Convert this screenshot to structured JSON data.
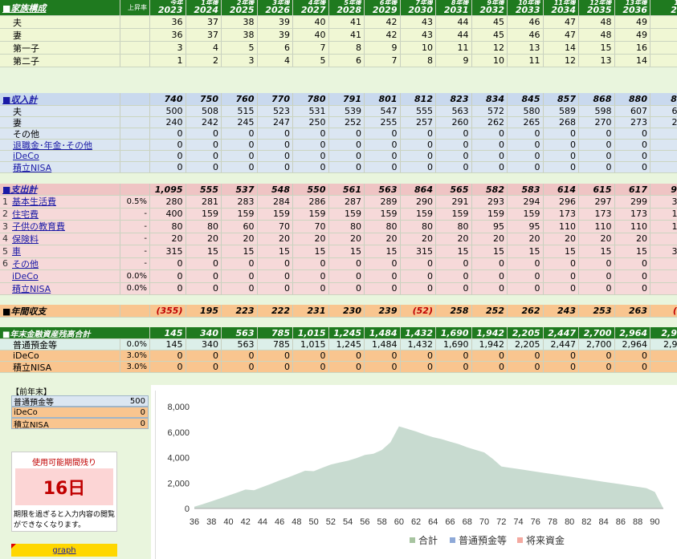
{
  "colors": {
    "navy_header": "#1f2a6e",
    "green_header": "#1f7a1f",
    "family_bg": "#f0f7d4",
    "income_bg": "#dbe6f2",
    "expense_bg": "#f6d9d9",
    "balance_bg": "#f9c58f",
    "assets_bg": "#dcefe9",
    "orange_row": "#f9c58f",
    "sheet_bg": "#e9f5dd",
    "chart_fill": "#c8dbd0"
  },
  "header": {
    "section_label": "■家族構成",
    "year_head_label": "上昇率",
    "years": [
      "2023",
      "2024",
      "2025",
      "2026",
      "2027",
      "2028",
      "2029",
      "2030",
      "2031",
      "2032",
      "2033",
      "2034",
      "2035",
      "2036",
      "20"
    ],
    "age_labels": [
      "今年",
      "1年後",
      "2年後",
      "3年後",
      "4年後",
      "5年後",
      "6年後",
      "7年後",
      "8年後",
      "9年後",
      "10年後",
      "11年後",
      "12年後",
      "13年後",
      "14"
    ]
  },
  "family": [
    {
      "label": "夫",
      "values": [
        "36",
        "37",
        "38",
        "39",
        "40",
        "41",
        "42",
        "43",
        "44",
        "45",
        "46",
        "47",
        "48",
        "49",
        "5"
      ]
    },
    {
      "label": "妻",
      "values": [
        "36",
        "37",
        "38",
        "39",
        "40",
        "41",
        "42",
        "43",
        "44",
        "45",
        "46",
        "47",
        "48",
        "49",
        "5"
      ]
    },
    {
      "label": "第一子",
      "values": [
        "3",
        "4",
        "5",
        "6",
        "7",
        "8",
        "9",
        "10",
        "11",
        "12",
        "13",
        "14",
        "15",
        "16",
        "1"
      ]
    },
    {
      "label": "第二子",
      "values": [
        "1",
        "2",
        "3",
        "4",
        "5",
        "6",
        "7",
        "8",
        "9",
        "10",
        "11",
        "12",
        "13",
        "14",
        "1"
      ]
    }
  ],
  "income": {
    "title": "■収入計",
    "totals": [
      "740",
      "750",
      "760",
      "770",
      "780",
      "791",
      "801",
      "812",
      "823",
      "834",
      "845",
      "857",
      "868",
      "880",
      "89"
    ],
    "rows": [
      {
        "label": "夫",
        "link": false,
        "values": [
          "500",
          "508",
          "515",
          "523",
          "531",
          "539",
          "547",
          "555",
          "563",
          "572",
          "580",
          "589",
          "598",
          "607",
          "61"
        ]
      },
      {
        "label": "妻",
        "link": false,
        "values": [
          "240",
          "242",
          "245",
          "247",
          "250",
          "252",
          "255",
          "257",
          "260",
          "262",
          "265",
          "268",
          "270",
          "273",
          "27"
        ]
      },
      {
        "label": "その他",
        "link": false,
        "values": [
          "0",
          "0",
          "0",
          "0",
          "0",
          "0",
          "0",
          "0",
          "0",
          "0",
          "0",
          "0",
          "0",
          "0",
          "0"
        ]
      },
      {
        "label": "退職金･年金･その他",
        "link": true,
        "values": [
          "0",
          "0",
          "0",
          "0",
          "0",
          "0",
          "0",
          "0",
          "0",
          "0",
          "0",
          "0",
          "0",
          "0",
          "0"
        ]
      },
      {
        "label": "iDeCo",
        "link": true,
        "values": [
          "0",
          "0",
          "0",
          "0",
          "0",
          "0",
          "0",
          "0",
          "0",
          "0",
          "0",
          "0",
          "0",
          "0",
          "0"
        ]
      },
      {
        "label": "積立NISA",
        "link": true,
        "values": [
          "0",
          "0",
          "0",
          "0",
          "0",
          "0",
          "0",
          "0",
          "0",
          "0",
          "0",
          "0",
          "0",
          "0",
          "0"
        ]
      }
    ]
  },
  "expense": {
    "title": "■支出計",
    "totals": [
      "1,095",
      "555",
      "537",
      "548",
      "550",
      "561",
      "563",
      "864",
      "565",
      "582",
      "583",
      "614",
      "615",
      "617",
      "91"
    ],
    "rows": [
      {
        "num": "1",
        "label": "基本生活費",
        "pct": "0.5%",
        "values": [
          "280",
          "281",
          "283",
          "284",
          "286",
          "287",
          "289",
          "290",
          "291",
          "293",
          "294",
          "296",
          "297",
          "299",
          "30"
        ]
      },
      {
        "num": "2",
        "label": "住宅費",
        "pct": "-",
        "values": [
          "400",
          "159",
          "159",
          "159",
          "159",
          "159",
          "159",
          "159",
          "159",
          "159",
          "159",
          "173",
          "173",
          "173",
          "17"
        ]
      },
      {
        "num": "3",
        "label": "子供の教育費",
        "pct": "-",
        "values": [
          "80",
          "80",
          "60",
          "70",
          "70",
          "80",
          "80",
          "80",
          "80",
          "95",
          "95",
          "110",
          "110",
          "110",
          "11"
        ]
      },
      {
        "num": "4",
        "label": "保険料",
        "pct": "-",
        "values": [
          "20",
          "20",
          "20",
          "20",
          "20",
          "20",
          "20",
          "20",
          "20",
          "20",
          "20",
          "20",
          "20",
          "20",
          "2"
        ]
      },
      {
        "num": "5",
        "label": "車",
        "pct": "-",
        "values": [
          "315",
          "15",
          "15",
          "15",
          "15",
          "15",
          "15",
          "315",
          "15",
          "15",
          "15",
          "15",
          "15",
          "15",
          "31"
        ]
      },
      {
        "num": "6",
        "label": "その他",
        "pct": "-",
        "values": [
          "0",
          "0",
          "0",
          "0",
          "0",
          "0",
          "0",
          "0",
          "0",
          "0",
          "0",
          "0",
          "0",
          "0",
          "0"
        ]
      },
      {
        "num": "",
        "label": "iDeCo",
        "pct": "0.0%",
        "values": [
          "0",
          "0",
          "0",
          "0",
          "0",
          "0",
          "0",
          "0",
          "0",
          "0",
          "0",
          "0",
          "0",
          "0",
          "0"
        ]
      },
      {
        "num": "",
        "label": "積立NISA",
        "pct": "0.0%",
        "values": [
          "0",
          "0",
          "0",
          "0",
          "0",
          "0",
          "0",
          "0",
          "0",
          "0",
          "0",
          "0",
          "0",
          "0",
          "0"
        ]
      }
    ]
  },
  "balance": {
    "title": "■年間収支",
    "values": [
      "(355)",
      "195",
      "223",
      "222",
      "231",
      "230",
      "239",
      "(52)",
      "258",
      "252",
      "262",
      "243",
      "253",
      "263",
      "(2"
    ]
  },
  "assets": {
    "title": "■年末金融資産残高合計",
    "totals": [
      "145",
      "340",
      "563",
      "785",
      "1,015",
      "1,245",
      "1,484",
      "1,432",
      "1,690",
      "1,942",
      "2,205",
      "2,447",
      "2,700",
      "2,964",
      "2,93"
    ],
    "rows": [
      {
        "label": "普通預金等",
        "pct": "0.0%",
        "values": [
          "145",
          "340",
          "563",
          "785",
          "1,015",
          "1,245",
          "1,484",
          "1,432",
          "1,690",
          "1,942",
          "2,205",
          "2,447",
          "2,700",
          "2,964",
          "2,93"
        ]
      },
      {
        "label": "iDeCo",
        "pct": "3.0%",
        "values": [
          "0",
          "0",
          "0",
          "0",
          "0",
          "0",
          "0",
          "0",
          "0",
          "0",
          "0",
          "0",
          "0",
          "0",
          "0"
        ]
      },
      {
        "label": "積立NISA",
        "pct": "3.0%",
        "values": [
          "0",
          "0",
          "0",
          "0",
          "0",
          "0",
          "0",
          "0",
          "0",
          "0",
          "0",
          "0",
          "0",
          "0",
          "0"
        ]
      }
    ]
  },
  "panel": {
    "prev_year_label": "【前年末】",
    "items": [
      {
        "label": "普通預金等",
        "value": "500"
      },
      {
        "label": "iDeCo",
        "value": "0"
      },
      {
        "label": "積立NISA",
        "value": "0"
      }
    ],
    "trial_title": "使用可能期間残り",
    "trial_days": "16日",
    "trial_note": "期限を過ぎると入力内容の閲覧ができなくなります。",
    "graph_link": "graph"
  },
  "chart_data": {
    "type": "area",
    "x": [
      36,
      37,
      38,
      39,
      40,
      41,
      42,
      43,
      44,
      45,
      46,
      47,
      48,
      49,
      50,
      51,
      52,
      53,
      54,
      55,
      56,
      57,
      58,
      59,
      60,
      61,
      62,
      63,
      64,
      65,
      66,
      67,
      68,
      69,
      70,
      71,
      72,
      73,
      74,
      75,
      76,
      77,
      78,
      79,
      80,
      81,
      82,
      83,
      84,
      85,
      86,
      87,
      88,
      89,
      90,
      91
    ],
    "xticks": [
      "36",
      "38",
      "40",
      "42",
      "44",
      "46",
      "48",
      "50",
      "52",
      "54",
      "56",
      "58",
      "60",
      "62",
      "64",
      "66",
      "68",
      "70",
      "72",
      "74",
      "76",
      "78",
      "80",
      "82",
      "84",
      "86",
      "88",
      "90"
    ],
    "series": [
      {
        "name": "合計",
        "values": [
          145,
          340,
          563,
          785,
          1015,
          1245,
          1484,
          1432,
          1690,
          1942,
          2205,
          2447,
          2700,
          2964,
          2930,
          3200,
          3450,
          3600,
          3750,
          3950,
          4200,
          4300,
          4600,
          5200,
          6450,
          6250,
          6050,
          5800,
          5600,
          5450,
          5250,
          5050,
          4800,
          4600,
          4400,
          3900,
          3300,
          3200,
          3100,
          3000,
          2900,
          2800,
          2700,
          2600,
          2500,
          2400,
          2300,
          2200,
          2100,
          2000,
          1900,
          1800,
          1700,
          1600,
          1300,
          0
        ]
      }
    ],
    "legend": [
      "合計",
      "普通預金等",
      "将来資金"
    ],
    "ylim": [
      0,
      8000
    ],
    "yticks": [
      "8,000",
      "6,000",
      "4,000",
      "2,000",
      "0"
    ],
    "legend_position": "bottom"
  }
}
